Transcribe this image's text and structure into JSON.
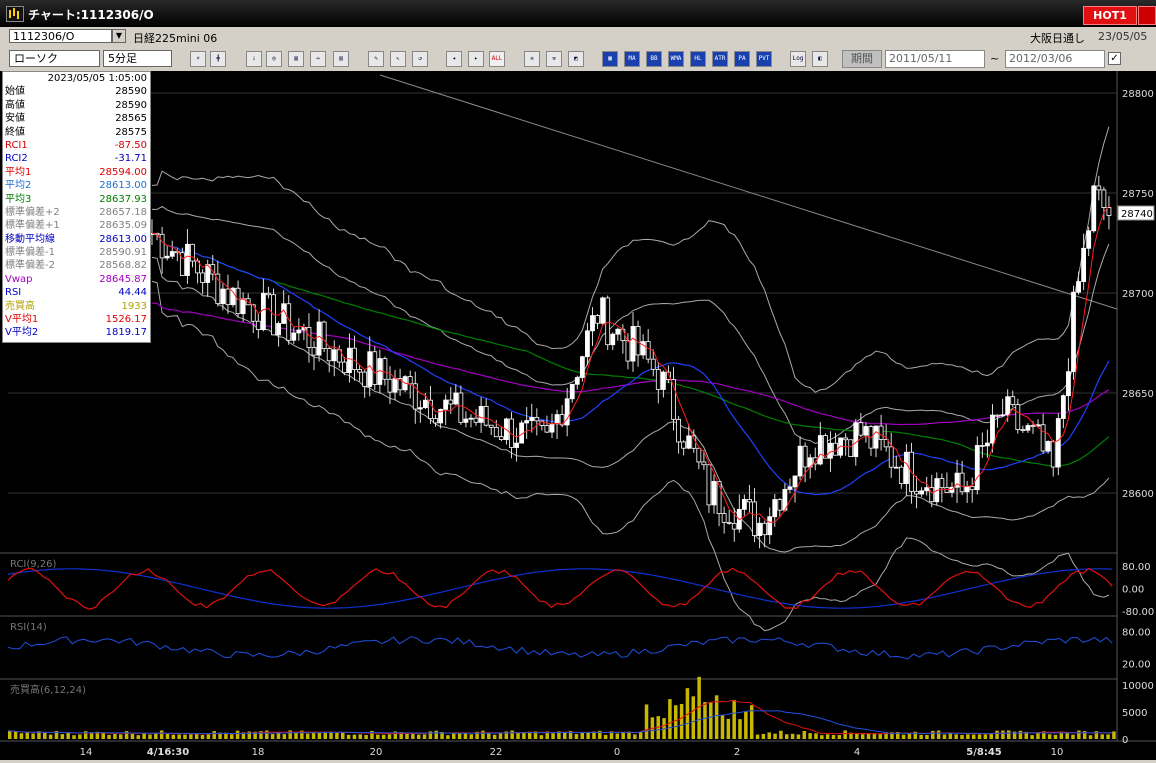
{
  "window": {
    "title": "チャート:1112306/O",
    "hot_label": "HOT1"
  },
  "row1": {
    "symbol": "1112306/O",
    "market_name": "日経225mini 06",
    "session": "大阪日通し",
    "date": "23/05/05"
  },
  "toolbar": {
    "chart_type": "ローソク",
    "interval": "5分足",
    "period_label": "期間",
    "date_from": "2011/05/11",
    "date_to": "2012/03/06",
    "tilde": "~",
    "check": "✓",
    "buttons": [
      "MA",
      "BB",
      "WMA",
      "HL",
      "ATR",
      "PA",
      "PVT",
      "Log",
      "ALL"
    ]
  },
  "infopanel": {
    "timestamp": "2023/05/05 1:05:00",
    "rows": [
      {
        "label": "始値",
        "value": "28590",
        "color": "#000000"
      },
      {
        "label": "高値",
        "value": "28590",
        "color": "#000000"
      },
      {
        "label": "安値",
        "value": "28565",
        "color": "#000000"
      },
      {
        "label": "終値",
        "value": "28575",
        "color": "#000000"
      },
      {
        "label": "RCI1",
        "value": "-87.50",
        "color": "#d00000"
      },
      {
        "label": "RCI2",
        "value": "-31.71",
        "color": "#0000c0"
      },
      {
        "label": "平均1",
        "value": "28594.00",
        "color": "#e00000"
      },
      {
        "label": "平均2",
        "value": "28613.00",
        "color": "#2070d0"
      },
      {
        "label": "平均3",
        "value": "28637.93",
        "color": "#008000"
      },
      {
        "label": "標準偏差+2",
        "value": "28657.18",
        "color": "#808080"
      },
      {
        "label": "標準偏差+1",
        "value": "28635.09",
        "color": "#808080"
      },
      {
        "label": "移動平均線",
        "value": "28613.00",
        "color": "#0000c0"
      },
      {
        "label": "標準偏差-1",
        "value": "28590.91",
        "color": "#808080"
      },
      {
        "label": "標準偏差-2",
        "value": "28568.82",
        "color": "#808080"
      },
      {
        "label": "Vwap",
        "value": "28645.87",
        "color": "#a000c0"
      },
      {
        "label": "RSI",
        "value": "44.44",
        "color": "#0000c0"
      },
      {
        "label": "売買高",
        "value": "1933",
        "color": "#b0a000"
      },
      {
        "label": "V平均1",
        "value": "1526.17",
        "color": "#e00000"
      },
      {
        "label": "V平均2",
        "value": "1819.17",
        "color": "#0000c0"
      }
    ]
  },
  "chart_data": {
    "type": "line",
    "price_axis": {
      "ticks": [
        "28800",
        "28750",
        "28700",
        "28650",
        "28600"
      ],
      "current": "28740"
    },
    "x_labels": [
      "14",
      "4/16:30",
      "18",
      "20",
      "22",
      "0",
      "2",
      "4",
      "5/8:45",
      "10"
    ],
    "rci_panel": {
      "label": "RCI(9,26)",
      "ticks": [
        "80.00",
        "0.00",
        "-80.00"
      ]
    },
    "rsi_panel": {
      "label": "RSI(14)",
      "ticks": [
        "80.00",
        "20.00"
      ]
    },
    "volume_panel": {
      "label": "売買高(6,12,24)",
      "ticks": [
        "10000",
        "5000",
        "0"
      ]
    }
  }
}
